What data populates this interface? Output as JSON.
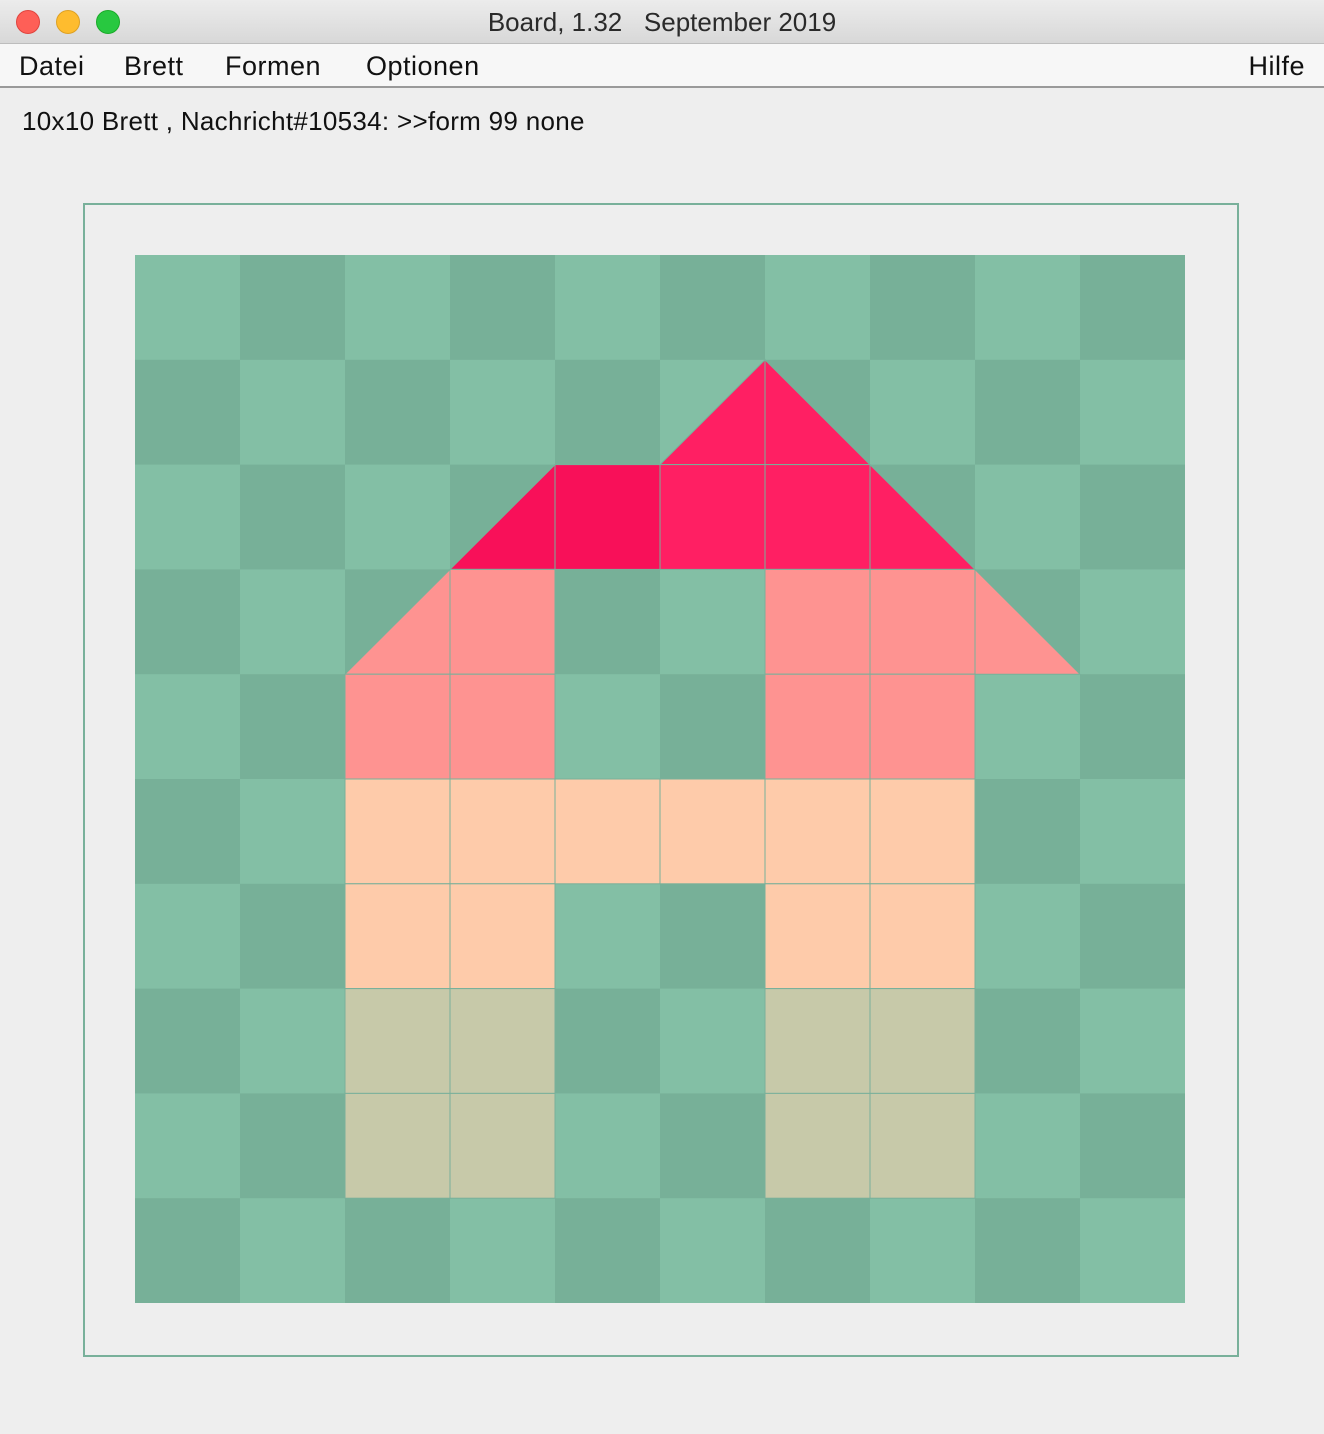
{
  "window": {
    "title": "Board, 1.32   September 2019"
  },
  "menu": {
    "datei": "Datei",
    "brett": "Brett",
    "formen": "Formen",
    "optionen": "Optionen",
    "hilfe": "Hilfe"
  },
  "status": {
    "text": "10x10 Brett , Nachricht#10534: >>form 99 none"
  },
  "board": {
    "rows": 10,
    "cols": 10,
    "colors": {
      "light": "#83bfa5",
      "dark": "#77b098",
      "grid_line": "#78b09a",
      "frame": "#78b09a",
      "roof": "#ff1f63",
      "roof_dark": "#f81059",
      "salmon": "#fe9391",
      "peach": "#fecbaa",
      "olive": "#c7c9a9"
    },
    "shaded_cells": [
      {
        "row": 1,
        "col": 5,
        "shape": "triangle-bottom-left",
        "fill": "roof"
      },
      {
        "row": 1,
        "col": 6,
        "shape": "triangle-bottom-right",
        "fill": "roof"
      },
      {
        "row": 2,
        "col": 3,
        "shape": "triangle-bottom-left",
        "fill": "roof_dark"
      },
      {
        "row": 2,
        "col": 4,
        "shape": "square",
        "fill": "roof_dark"
      },
      {
        "row": 2,
        "col": 5,
        "shape": "square",
        "fill": "roof"
      },
      {
        "row": 2,
        "col": 6,
        "shape": "square",
        "fill": "roof"
      },
      {
        "row": 2,
        "col": 7,
        "shape": "triangle-bottom-right",
        "fill": "roof"
      },
      {
        "row": 3,
        "col": 2,
        "shape": "triangle-bottom-left",
        "fill": "salmon"
      },
      {
        "row": 3,
        "col": 3,
        "shape": "square",
        "fill": "salmon"
      },
      {
        "row": 3,
        "col": 6,
        "shape": "square",
        "fill": "salmon"
      },
      {
        "row": 3,
        "col": 7,
        "shape": "square",
        "fill": "salmon"
      },
      {
        "row": 3,
        "col": 8,
        "shape": "triangle-bottom-right",
        "fill": "salmon"
      },
      {
        "row": 4,
        "col": 2,
        "shape": "square",
        "fill": "salmon"
      },
      {
        "row": 4,
        "col": 3,
        "shape": "square",
        "fill": "salmon"
      },
      {
        "row": 4,
        "col": 6,
        "shape": "square",
        "fill": "salmon"
      },
      {
        "row": 4,
        "col": 7,
        "shape": "square",
        "fill": "salmon"
      },
      {
        "row": 5,
        "col": 2,
        "shape": "square",
        "fill": "peach"
      },
      {
        "row": 5,
        "col": 3,
        "shape": "square",
        "fill": "peach"
      },
      {
        "row": 5,
        "col": 4,
        "shape": "square",
        "fill": "peach"
      },
      {
        "row": 5,
        "col": 5,
        "shape": "square",
        "fill": "peach"
      },
      {
        "row": 5,
        "col": 6,
        "shape": "square",
        "fill": "peach"
      },
      {
        "row": 5,
        "col": 7,
        "shape": "square",
        "fill": "peach"
      },
      {
        "row": 6,
        "col": 2,
        "shape": "square",
        "fill": "peach"
      },
      {
        "row": 6,
        "col": 3,
        "shape": "square",
        "fill": "peach"
      },
      {
        "row": 6,
        "col": 6,
        "shape": "square",
        "fill": "peach"
      },
      {
        "row": 6,
        "col": 7,
        "shape": "square",
        "fill": "peach"
      },
      {
        "row": 7,
        "col": 2,
        "shape": "square",
        "fill": "olive"
      },
      {
        "row": 7,
        "col": 3,
        "shape": "square",
        "fill": "olive"
      },
      {
        "row": 7,
        "col": 6,
        "shape": "square",
        "fill": "olive"
      },
      {
        "row": 7,
        "col": 7,
        "shape": "square",
        "fill": "olive"
      },
      {
        "row": 8,
        "col": 2,
        "shape": "square",
        "fill": "olive"
      },
      {
        "row": 8,
        "col": 3,
        "shape": "square",
        "fill": "olive"
      },
      {
        "row": 8,
        "col": 6,
        "shape": "square",
        "fill": "olive"
      },
      {
        "row": 8,
        "col": 7,
        "shape": "square",
        "fill": "olive"
      }
    ]
  }
}
